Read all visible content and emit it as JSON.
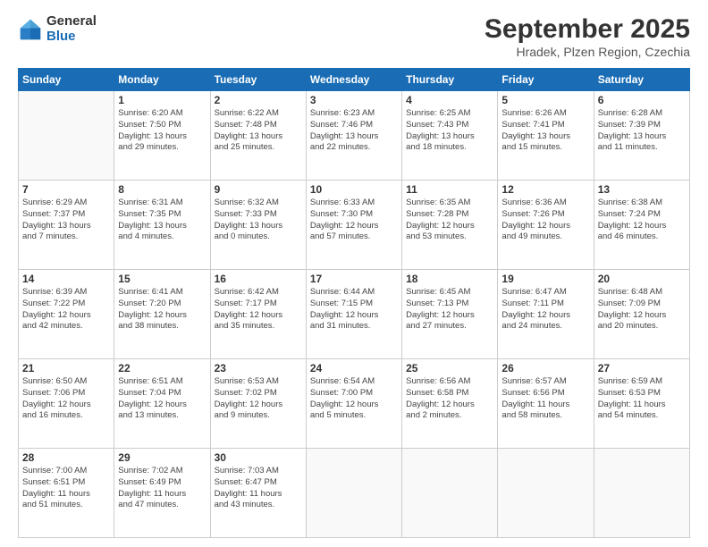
{
  "logo": {
    "general": "General",
    "blue": "Blue"
  },
  "header": {
    "month": "September 2025",
    "location": "Hradek, Plzen Region, Czechia"
  },
  "weekdays": [
    "Sunday",
    "Monday",
    "Tuesday",
    "Wednesday",
    "Thursday",
    "Friday",
    "Saturday"
  ],
  "weeks": [
    [
      {
        "day": "",
        "info": ""
      },
      {
        "day": "1",
        "info": "Sunrise: 6:20 AM\nSunset: 7:50 PM\nDaylight: 13 hours\nand 29 minutes."
      },
      {
        "day": "2",
        "info": "Sunrise: 6:22 AM\nSunset: 7:48 PM\nDaylight: 13 hours\nand 25 minutes."
      },
      {
        "day": "3",
        "info": "Sunrise: 6:23 AM\nSunset: 7:46 PM\nDaylight: 13 hours\nand 22 minutes."
      },
      {
        "day": "4",
        "info": "Sunrise: 6:25 AM\nSunset: 7:43 PM\nDaylight: 13 hours\nand 18 minutes."
      },
      {
        "day": "5",
        "info": "Sunrise: 6:26 AM\nSunset: 7:41 PM\nDaylight: 13 hours\nand 15 minutes."
      },
      {
        "day": "6",
        "info": "Sunrise: 6:28 AM\nSunset: 7:39 PM\nDaylight: 13 hours\nand 11 minutes."
      }
    ],
    [
      {
        "day": "7",
        "info": "Sunrise: 6:29 AM\nSunset: 7:37 PM\nDaylight: 13 hours\nand 7 minutes."
      },
      {
        "day": "8",
        "info": "Sunrise: 6:31 AM\nSunset: 7:35 PM\nDaylight: 13 hours\nand 4 minutes."
      },
      {
        "day": "9",
        "info": "Sunrise: 6:32 AM\nSunset: 7:33 PM\nDaylight: 13 hours\nand 0 minutes."
      },
      {
        "day": "10",
        "info": "Sunrise: 6:33 AM\nSunset: 7:30 PM\nDaylight: 12 hours\nand 57 minutes."
      },
      {
        "day": "11",
        "info": "Sunrise: 6:35 AM\nSunset: 7:28 PM\nDaylight: 12 hours\nand 53 minutes."
      },
      {
        "day": "12",
        "info": "Sunrise: 6:36 AM\nSunset: 7:26 PM\nDaylight: 12 hours\nand 49 minutes."
      },
      {
        "day": "13",
        "info": "Sunrise: 6:38 AM\nSunset: 7:24 PM\nDaylight: 12 hours\nand 46 minutes."
      }
    ],
    [
      {
        "day": "14",
        "info": "Sunrise: 6:39 AM\nSunset: 7:22 PM\nDaylight: 12 hours\nand 42 minutes."
      },
      {
        "day": "15",
        "info": "Sunrise: 6:41 AM\nSunset: 7:20 PM\nDaylight: 12 hours\nand 38 minutes."
      },
      {
        "day": "16",
        "info": "Sunrise: 6:42 AM\nSunset: 7:17 PM\nDaylight: 12 hours\nand 35 minutes."
      },
      {
        "day": "17",
        "info": "Sunrise: 6:44 AM\nSunset: 7:15 PM\nDaylight: 12 hours\nand 31 minutes."
      },
      {
        "day": "18",
        "info": "Sunrise: 6:45 AM\nSunset: 7:13 PM\nDaylight: 12 hours\nand 27 minutes."
      },
      {
        "day": "19",
        "info": "Sunrise: 6:47 AM\nSunset: 7:11 PM\nDaylight: 12 hours\nand 24 minutes."
      },
      {
        "day": "20",
        "info": "Sunrise: 6:48 AM\nSunset: 7:09 PM\nDaylight: 12 hours\nand 20 minutes."
      }
    ],
    [
      {
        "day": "21",
        "info": "Sunrise: 6:50 AM\nSunset: 7:06 PM\nDaylight: 12 hours\nand 16 minutes."
      },
      {
        "day": "22",
        "info": "Sunrise: 6:51 AM\nSunset: 7:04 PM\nDaylight: 12 hours\nand 13 minutes."
      },
      {
        "day": "23",
        "info": "Sunrise: 6:53 AM\nSunset: 7:02 PM\nDaylight: 12 hours\nand 9 minutes."
      },
      {
        "day": "24",
        "info": "Sunrise: 6:54 AM\nSunset: 7:00 PM\nDaylight: 12 hours\nand 5 minutes."
      },
      {
        "day": "25",
        "info": "Sunrise: 6:56 AM\nSunset: 6:58 PM\nDaylight: 12 hours\nand 2 minutes."
      },
      {
        "day": "26",
        "info": "Sunrise: 6:57 AM\nSunset: 6:56 PM\nDaylight: 11 hours\nand 58 minutes."
      },
      {
        "day": "27",
        "info": "Sunrise: 6:59 AM\nSunset: 6:53 PM\nDaylight: 11 hours\nand 54 minutes."
      }
    ],
    [
      {
        "day": "28",
        "info": "Sunrise: 7:00 AM\nSunset: 6:51 PM\nDaylight: 11 hours\nand 51 minutes."
      },
      {
        "day": "29",
        "info": "Sunrise: 7:02 AM\nSunset: 6:49 PM\nDaylight: 11 hours\nand 47 minutes."
      },
      {
        "day": "30",
        "info": "Sunrise: 7:03 AM\nSunset: 6:47 PM\nDaylight: 11 hours\nand 43 minutes."
      },
      {
        "day": "",
        "info": ""
      },
      {
        "day": "",
        "info": ""
      },
      {
        "day": "",
        "info": ""
      },
      {
        "day": "",
        "info": ""
      }
    ]
  ]
}
